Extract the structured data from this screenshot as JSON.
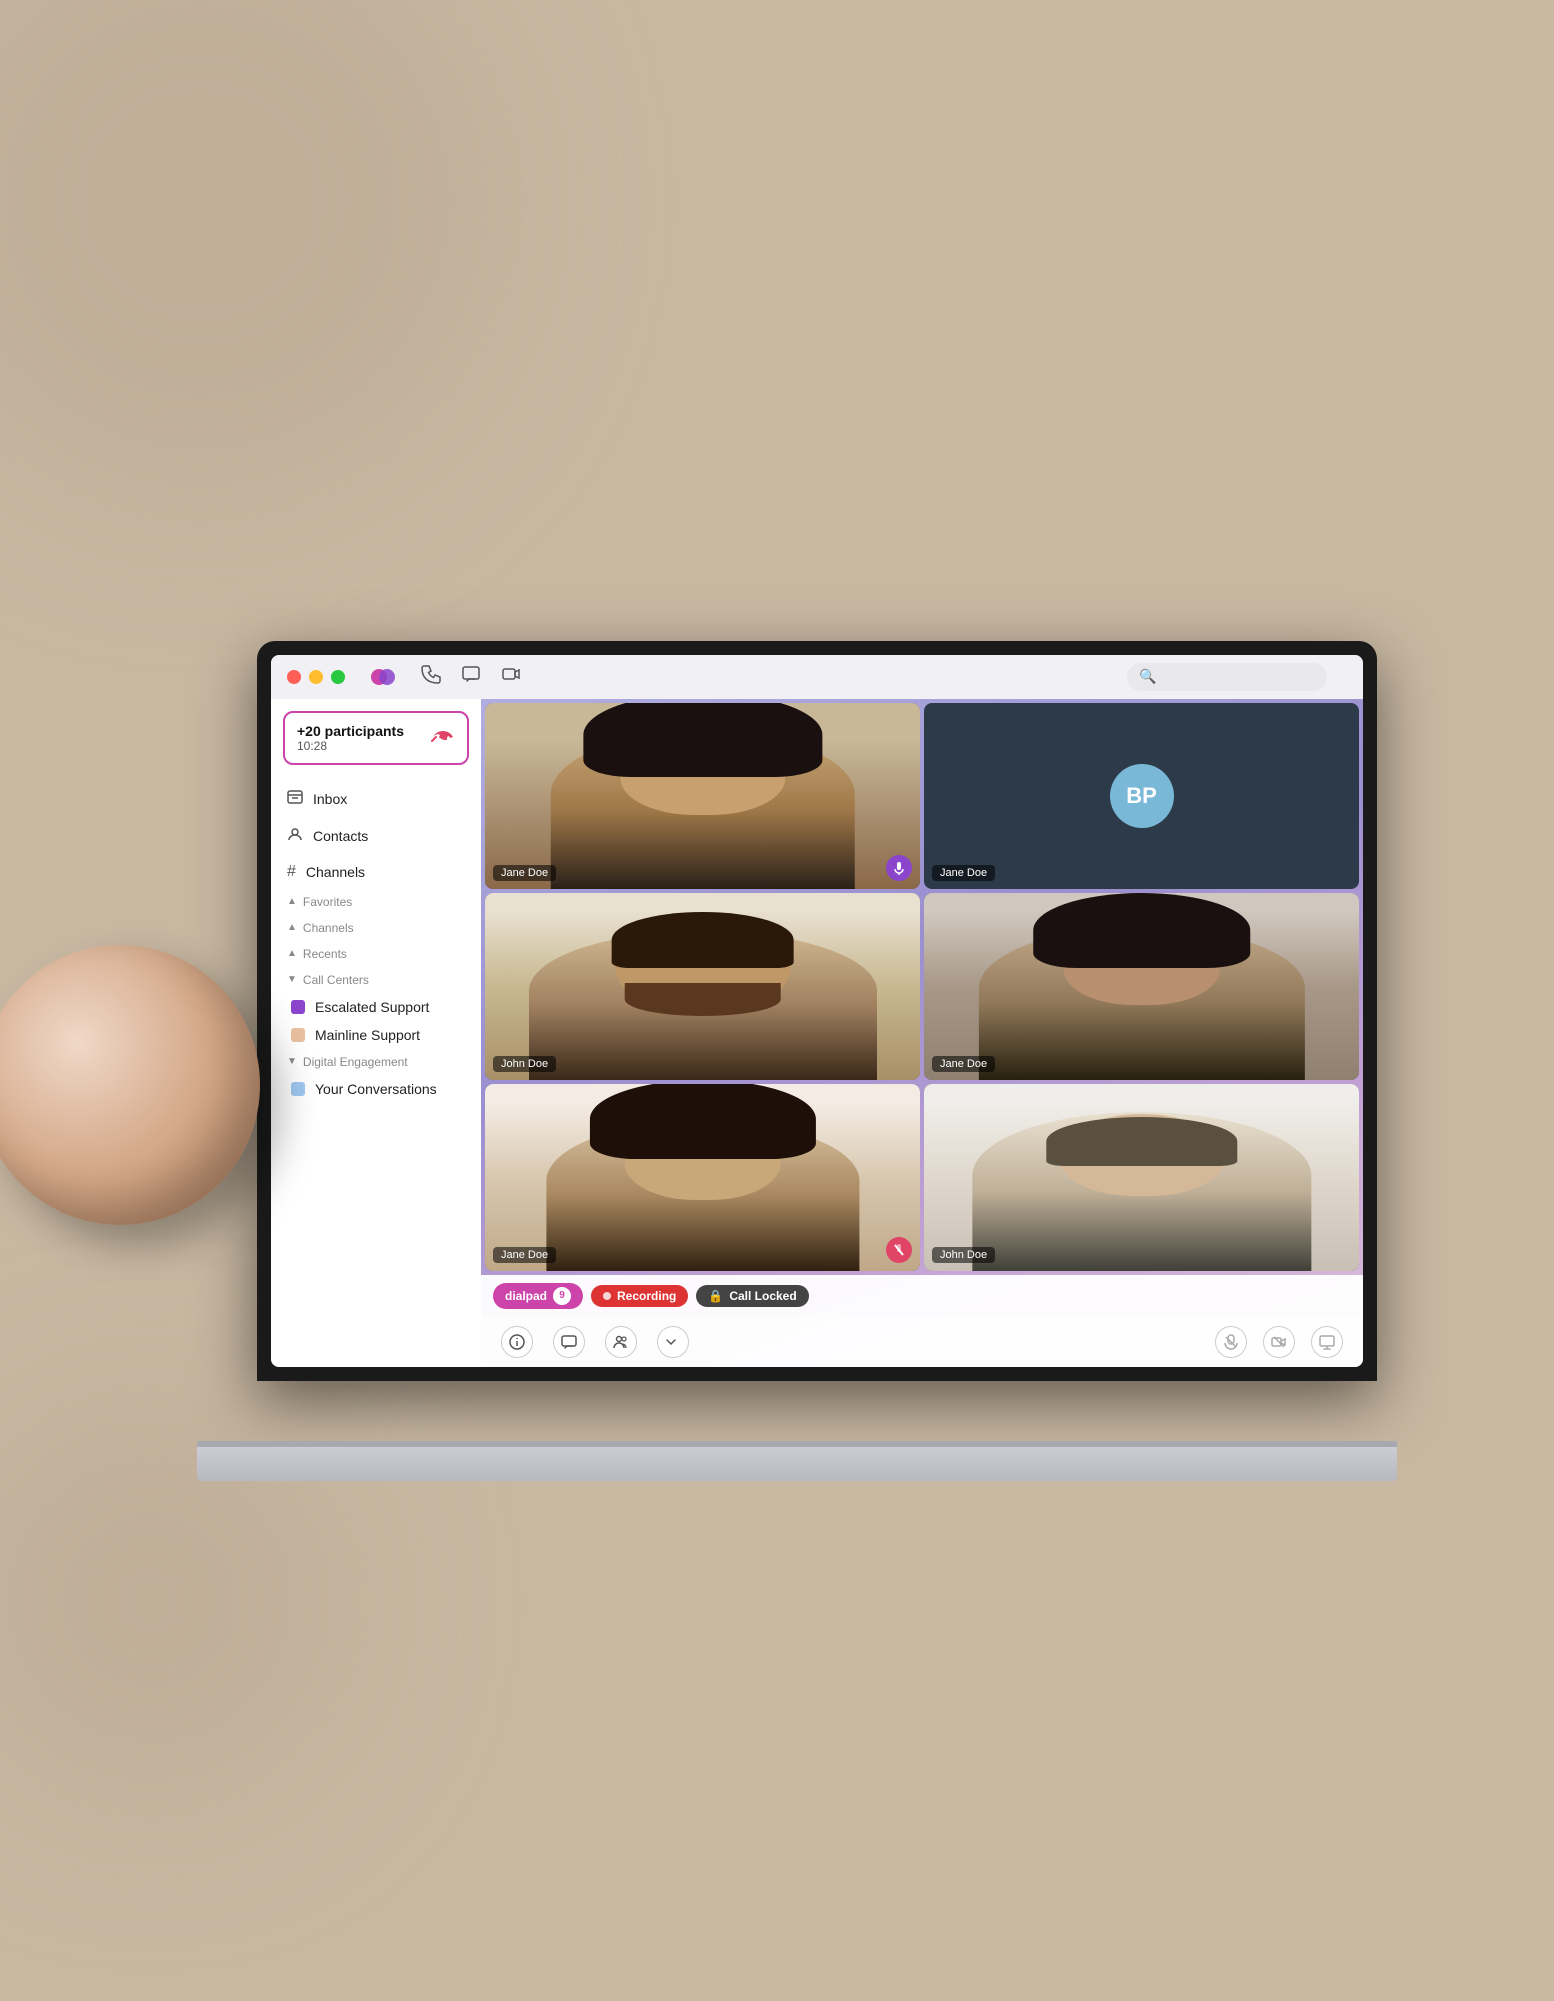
{
  "window": {
    "controls": {
      "close": "close",
      "minimize": "minimize",
      "maximize": "maximize"
    }
  },
  "toolbar": {
    "phone_icon": "☎",
    "chat_icon": "💬",
    "video_icon": "📹",
    "search_placeholder": "Search"
  },
  "sidebar": {
    "call_card": {
      "participants": "+20 participants",
      "duration": "10:28"
    },
    "nav_items": [
      {
        "label": "Inbox",
        "icon": "📥"
      },
      {
        "label": "Contacts",
        "icon": "👤"
      },
      {
        "label": "Channels",
        "icon": "#"
      }
    ],
    "sections": [
      {
        "label": "Favorites",
        "collapsed": false
      },
      {
        "label": "Channels",
        "collapsed": false
      },
      {
        "label": "Recents",
        "collapsed": false
      },
      {
        "label": "Call Centers",
        "collapsed": false
      }
    ],
    "call_centers": [
      {
        "label": "Escalated Support",
        "color": "purple"
      },
      {
        "label": "Mainline Support",
        "color": "peach"
      }
    ],
    "digital_engagement": {
      "header": "Digital Engagement",
      "items": [
        {
          "label": "Your Conversations",
          "color": "blue"
        }
      ]
    }
  },
  "video_grid": {
    "tiles": [
      {
        "id": 1,
        "name": "Jane Doe",
        "active_speaker": true,
        "has_audio_badge": true,
        "muted": false
      },
      {
        "id": 2,
        "name": "Jane Doe",
        "active_speaker": false,
        "avatar_initials": "BP",
        "has_audio_badge": false
      },
      {
        "id": 3,
        "name": "John Doe",
        "active_speaker": false,
        "has_audio_badge": false,
        "muted": false
      },
      {
        "id": 4,
        "name": "Jane Doe",
        "active_speaker": false,
        "has_audio_badge": false,
        "muted": false
      },
      {
        "id": 5,
        "name": "Jane Doe",
        "active_speaker": false,
        "has_audio_badge": false,
        "muted": true
      },
      {
        "id": 6,
        "name": "John Doe",
        "active_speaker": false,
        "has_audio_badge": false,
        "muted": false
      }
    ]
  },
  "status_bar": {
    "badges": [
      {
        "label": "dialpad",
        "type": "dialpad",
        "count": 9
      },
      {
        "label": "Recording",
        "type": "recording"
      },
      {
        "label": "Call Locked",
        "type": "locked"
      }
    ]
  },
  "call_toolbar": {
    "left_buttons": [
      {
        "id": "info",
        "icon": "ℹ",
        "label": "Info"
      },
      {
        "id": "chat",
        "icon": "💬",
        "label": "Chat"
      },
      {
        "id": "participants",
        "icon": "👥",
        "label": "Participants"
      },
      {
        "id": "settings",
        "icon": "⚙",
        "label": "Settings"
      }
    ],
    "right_buttons": [
      {
        "id": "mute",
        "icon": "🎙",
        "label": "Mute",
        "muted": true
      },
      {
        "id": "video-off",
        "icon": "📷",
        "label": "Video Off",
        "muted": true
      },
      {
        "id": "screen-share",
        "icon": "🖥",
        "label": "Screen Share",
        "muted": true
      }
    ]
  },
  "colors": {
    "accent_purple": "#8b44cc",
    "accent_pink": "#cc44aa",
    "recording_red": "#dd3333",
    "dark": "#444444",
    "active_speaker_border": "#8b44cc"
  }
}
